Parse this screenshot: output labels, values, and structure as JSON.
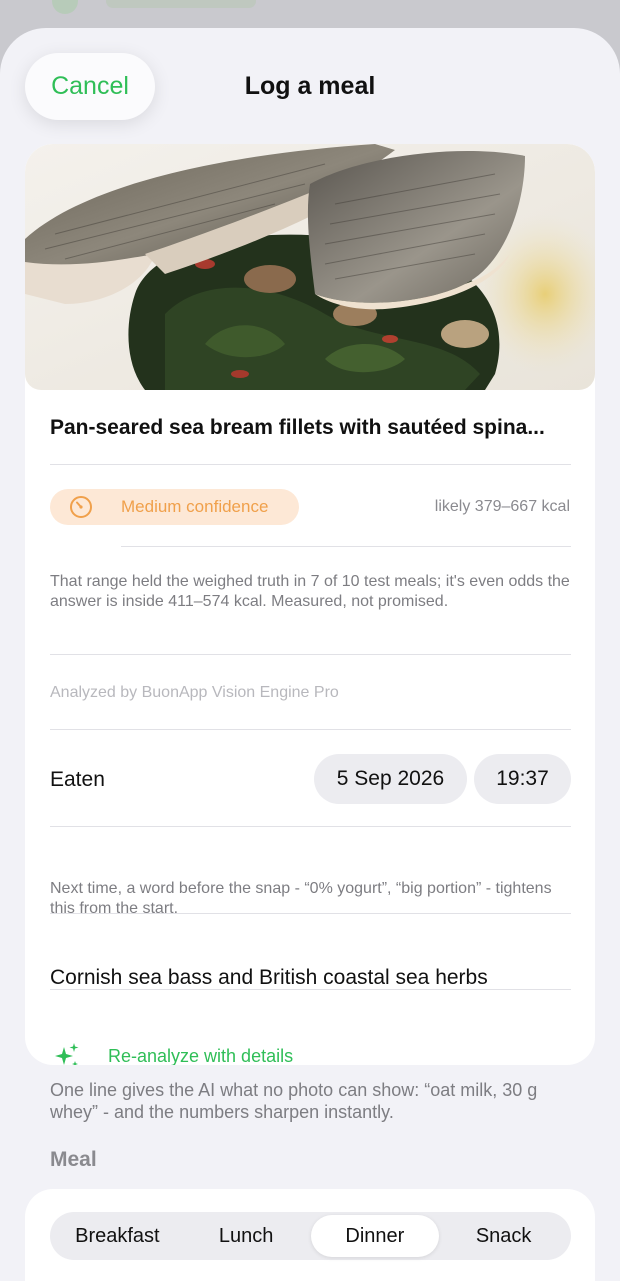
{
  "header": {
    "cancel_label": "Cancel",
    "title": "Log a meal"
  },
  "meal": {
    "name": "Pan-seared sea bream fillets with sautéed spina...",
    "confidence_label": "Medium confidence",
    "kcal_range": "likely 379–667 kcal",
    "explanation": "That range held the weighed truth in 7 of 10 test meals; it's even odds the answer is inside 411–574 kcal. Measured, not promised.",
    "engine": "Analyzed by BuonApp Vision Engine Pro"
  },
  "eaten": {
    "label": "Eaten",
    "date": "5 Sep 2026",
    "time": "19:37"
  },
  "details": {
    "hint": "Next time, a word before the snap - “0% yogurt”, “big portion” - tightens this from the start.",
    "value": "Cornish sea bass and British coastal sea herbs",
    "reanalyze_label": "Re-analyze with details"
  },
  "footnote": "One line gives the AI what no photo can show: “oat milk, 30 g whey” - and the numbers sharpen instantly.",
  "meal_type": {
    "heading": "Meal",
    "options": [
      "Breakfast",
      "Lunch",
      "Dinner",
      "Snack"
    ],
    "selected": "Dinner"
  },
  "colors": {
    "accent": "#2fbe57",
    "confidence_bg": "#fde8d6",
    "confidence_fg": "#f0a04b",
    "sheet_bg": "#f2f2f7"
  }
}
